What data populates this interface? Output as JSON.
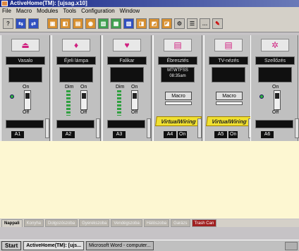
{
  "window": {
    "title": "ActiveHome(TM): [ujsag.x10]"
  },
  "menu": [
    "File",
    "Macro",
    "Modules",
    "Tools",
    "Configuration",
    "Window"
  ],
  "toolbar": {
    "buttons": [
      "help",
      "link",
      "link-alt",
      "module1",
      "module2",
      "module3",
      "module4",
      "module5",
      "module6",
      "module7",
      "module8",
      "module9",
      "module10",
      "module11",
      "module12",
      "module13"
    ]
  },
  "modules": [
    {
      "name": "Vasalo",
      "on": "On",
      "off": "Off",
      "addr": "A1"
    },
    {
      "name": "Éjeli lámpa",
      "dim": "Dim",
      "on": "On",
      "off": "Off",
      "addr": "A2"
    },
    {
      "name": "Falikar",
      "dim": "Dim",
      "on": "On",
      "off": "Off",
      "addr": "A3"
    },
    {
      "name": "Ébresztés",
      "days": "MTWTFSS",
      "time": "08:35am",
      "macro": "Macro",
      "vw": "VirtualWiring",
      "addr": "A4",
      "on_state": "On"
    },
    {
      "name": "TV-nézés",
      "macro": "Macro",
      "vw": "VirtualWiring",
      "addr": "A5",
      "on_state": "On"
    },
    {
      "name": "Szellőzés",
      "on": "On",
      "off": "Off",
      "addr": "A6"
    }
  ],
  "tabs": [
    "Nappali",
    "Konyha",
    "Dolgozószoba",
    "Gyerekszoba",
    "Vendégszoba",
    "Hálószoba",
    "Garázs",
    "Trash Can"
  ],
  "taskbar": {
    "start": "Start",
    "tasks": [
      "ActiveHome(TM): [ujs...",
      "Microsoft Word - computer..."
    ]
  }
}
